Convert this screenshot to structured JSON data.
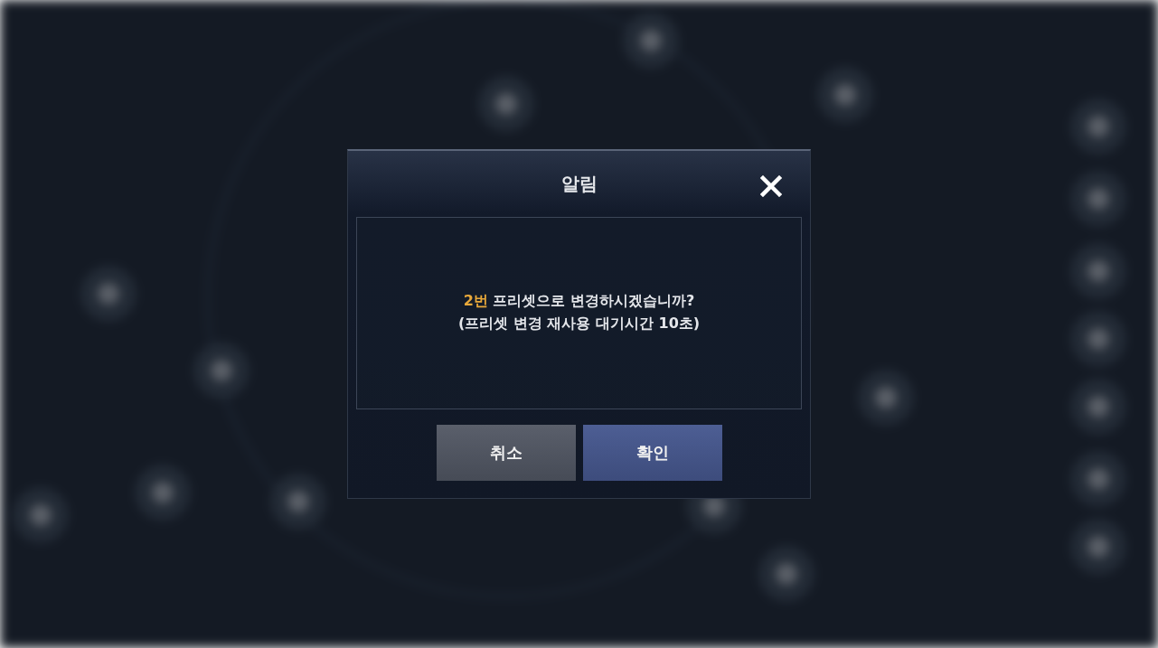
{
  "dialog": {
    "title": "알림",
    "message": {
      "highlight": "2번",
      "line1": "프리셋으로 변경하시겠습니까?",
      "line2": "(프리셋 변경 재사용 대기시간 10초)"
    },
    "buttons": [
      {
        "label": "취소",
        "kind": "cancel"
      },
      {
        "label": "확인",
        "kind": "confirm"
      }
    ]
  }
}
